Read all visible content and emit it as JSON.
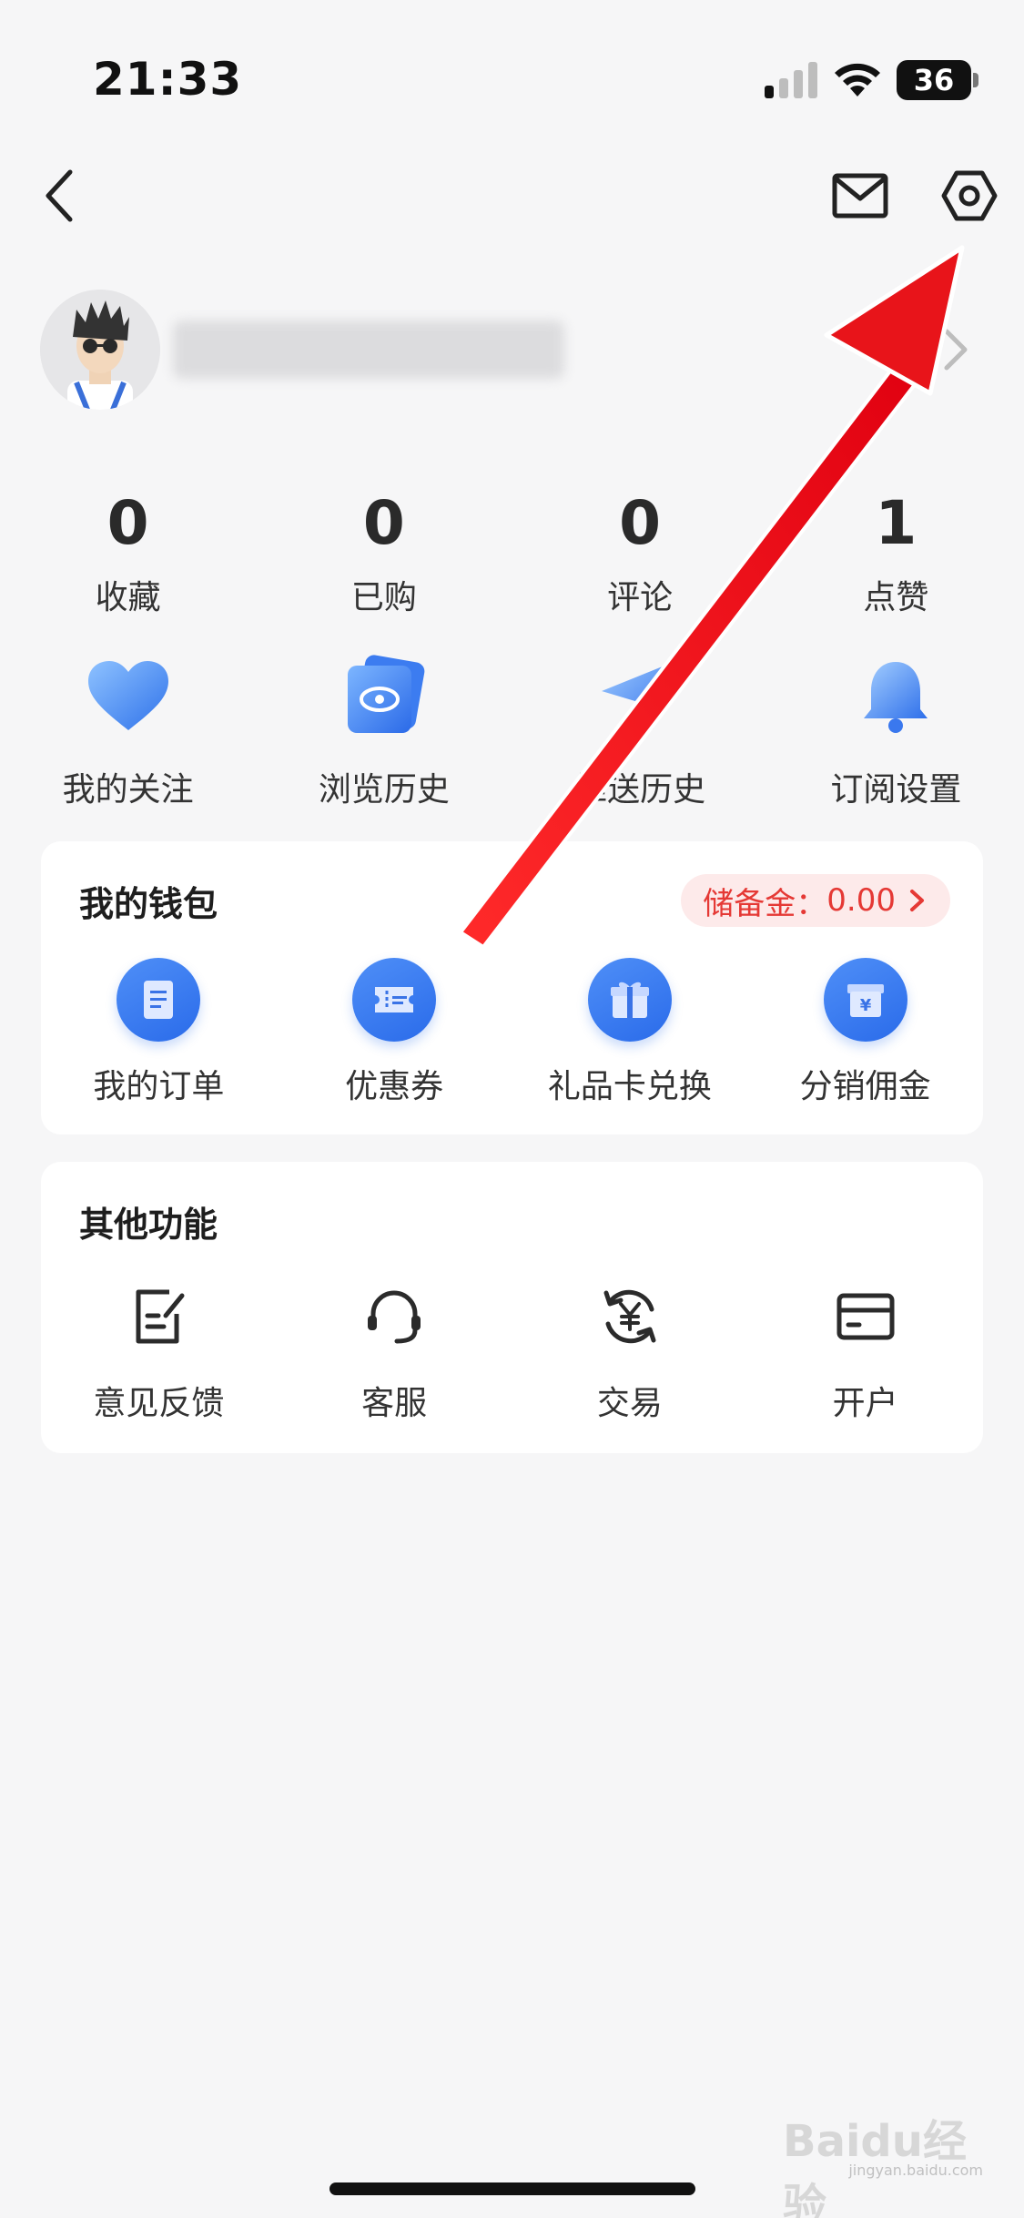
{
  "status_bar": {
    "time": "21:33",
    "battery": "36"
  },
  "nav": {
    "back_icon": "chevron-left-icon",
    "mail_icon": "mail-icon",
    "settings_icon": "settings-hexagon-icon"
  },
  "stats": [
    {
      "value": "0",
      "label": "收藏"
    },
    {
      "value": "0",
      "label": "已购"
    },
    {
      "value": "0",
      "label": "评论"
    },
    {
      "value": "1",
      "label": "点赞"
    }
  ],
  "quick_links": [
    {
      "label": "我的关注",
      "icon": "heart-icon"
    },
    {
      "label": "浏览历史",
      "icon": "eye-card-icon"
    },
    {
      "label": "推送历史",
      "icon": "paper-plane-icon"
    },
    {
      "label": "订阅设置",
      "icon": "bell-icon"
    }
  ],
  "wallet": {
    "title": "我的钱包",
    "reserve_label": "储备金：",
    "reserve_value": "0.00",
    "items": [
      {
        "label": "我的订单",
        "icon": "document-icon"
      },
      {
        "label": "优惠券",
        "icon": "coupon-icon"
      },
      {
        "label": "礼品卡兑换",
        "icon": "gift-icon"
      },
      {
        "label": "分销佣金",
        "icon": "yen-box-icon"
      }
    ]
  },
  "other": {
    "title": "其他功能",
    "items": [
      {
        "label": "意见反馈",
        "icon": "feedback-edit-icon"
      },
      {
        "label": "客服",
        "icon": "headset-icon"
      },
      {
        "label": "交易",
        "icon": "yen-exchange-icon"
      },
      {
        "label": "开户",
        "icon": "card-icon"
      }
    ]
  },
  "watermark": {
    "text": "Baidu经验",
    "sub": "jingyan.baidu.com"
  },
  "colors": {
    "accent_blue": "#2a6bea",
    "reserve_red": "#e53935",
    "annotation_red": "#e8141a"
  }
}
